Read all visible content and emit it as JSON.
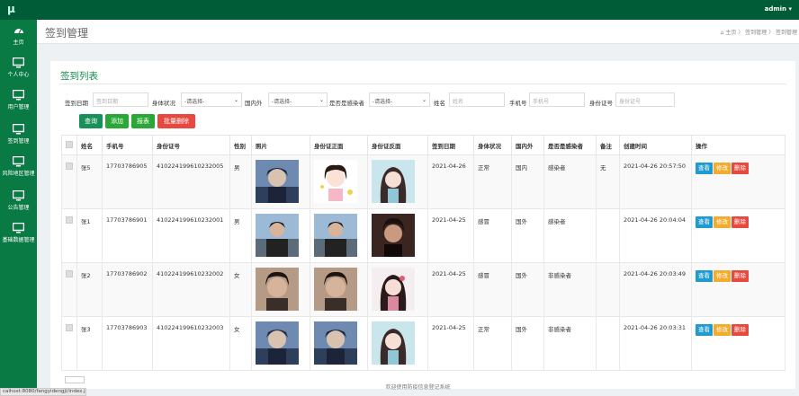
{
  "app": {
    "logo": "μ",
    "user_label": "admin ▾"
  },
  "sidebar": {
    "items": [
      {
        "label": "主页",
        "icon": "dashboard-icon"
      },
      {
        "label": "个人中心",
        "icon": "monitor-icon"
      },
      {
        "label": "用户管理",
        "icon": "monitor-icon"
      },
      {
        "label": "签到管理",
        "icon": "monitor-icon"
      },
      {
        "label": "风险地区管理",
        "icon": "monitor-icon"
      },
      {
        "label": "公告管理",
        "icon": "monitor-icon"
      },
      {
        "label": "基础数据管理",
        "icon": "monitor-icon"
      }
    ]
  },
  "header": {
    "title": "签到管理",
    "breadcrumb": "主页  〉 签到管理  〉 签到管理"
  },
  "panel": {
    "title": "签到列表"
  },
  "filters": {
    "date_label": "签到日期",
    "date_placeholder": "签到日期",
    "health_label": "身体状况",
    "health_value": "-请选择-",
    "domestic_label": "国内外",
    "domestic_value": "-请选择-",
    "infected_label": "是否是感染者",
    "infected_value": "-请选择-",
    "name_label": "姓名",
    "name_placeholder": "姓名",
    "phone_label": "手机号",
    "phone_placeholder": "手机号",
    "id_label": "身份证号",
    "id_placeholder": "身份证号"
  },
  "buttons": {
    "query": "查询",
    "add": "添加",
    "report": "报表",
    "batch_delete": "批量删除"
  },
  "table": {
    "headers": [
      "",
      "姓名",
      "手机号",
      "身份证号",
      "性别",
      "照片",
      "身份证正面",
      "身份证反面",
      "签到日期",
      "身体状况",
      "国内外",
      "是否是感染者",
      "备注",
      "创建时间",
      "操作"
    ],
    "actions": {
      "view": "查看",
      "edit": "修改",
      "delete": "删除"
    },
    "rows": [
      {
        "name": "张5",
        "phone": "17703786905",
        "id": "410224199610232005",
        "gender": "男",
        "date": "2021-04-26",
        "health": "正常",
        "domestic": "国内",
        "infected": "感染者",
        "note": "无",
        "created": "2021-04-26 20:57:50"
      },
      {
        "name": "张1",
        "phone": "17703786901",
        "id": "410224199610232001",
        "gender": "男",
        "date": "2021-04-25",
        "health": "感冒",
        "domestic": "国外",
        "infected": "感染者",
        "note": "",
        "created": "2021-04-26 20:04:04"
      },
      {
        "name": "张2",
        "phone": "17703786902",
        "id": "410224199610232002",
        "gender": "女",
        "date": "2021-04-25",
        "health": "感冒",
        "domestic": "国外",
        "infected": "非感染者",
        "note": "",
        "created": "2021-04-26 20:03:49"
      },
      {
        "name": "张3",
        "phone": "17703786903",
        "id": "410224199610232003",
        "gender": "女",
        "date": "2021-04-25",
        "health": "正常",
        "domestic": "国外",
        "infected": "非感染者",
        "note": "",
        "created": "2021-04-26 20:03:31"
      }
    ]
  },
  "footer": {
    "text": "欢迎使用防疫信息登记系统"
  },
  "statusbar": {
    "url": "calhost:8080/fangyidengji/index.jsp"
  },
  "colors": {
    "topbar": "#005c36",
    "sidebar": "#0a7a45",
    "accent": "#1a8a52",
    "view": "#1f9bcf",
    "edit": "#f0ad2e",
    "delete": "#e8493f"
  }
}
